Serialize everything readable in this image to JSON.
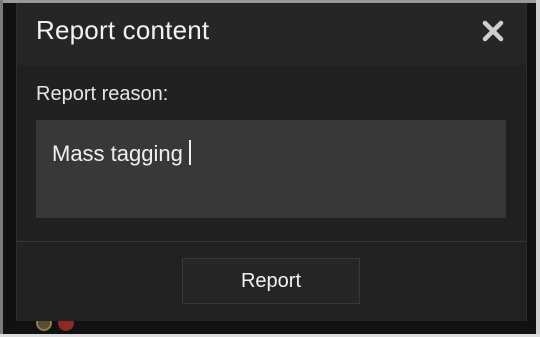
{
  "dialog": {
    "title": "Report content",
    "close_icon": "close-icon",
    "reason_label": "Report reason:",
    "reason_input": {
      "value": "Mass tagging",
      "placeholder": ""
    },
    "submit_label": "Report"
  },
  "colors": {
    "dialog_background": "#212121",
    "header_background": "#262626",
    "input_background": "#383838",
    "text": "#f2f2f2"
  }
}
